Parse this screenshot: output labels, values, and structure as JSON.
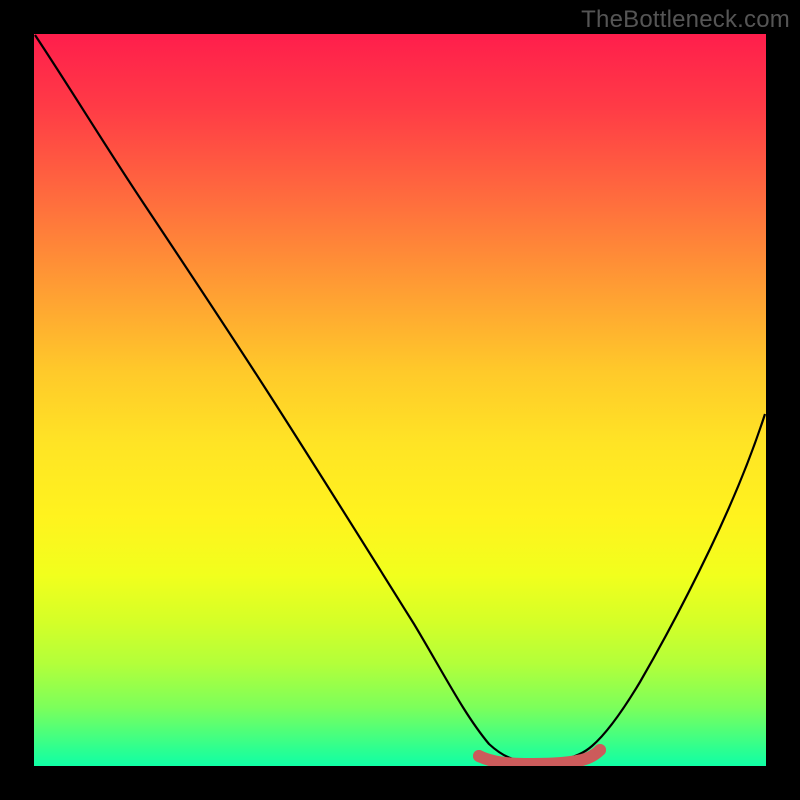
{
  "watermark": {
    "text": "TheBottleneck.com"
  },
  "chart_data": {
    "type": "line",
    "title": "",
    "xlabel": "",
    "ylabel": "",
    "xlim": [
      0,
      100
    ],
    "ylim": [
      0,
      100
    ],
    "grid": false,
    "legend": false,
    "series": [
      {
        "name": "bottleneck-curve",
        "x": [
          0,
          5,
          10,
          15,
          20,
          25,
          30,
          35,
          40,
          45,
          50,
          55,
          58,
          60,
          62,
          65,
          68,
          70,
          72,
          75,
          80,
          85,
          90,
          95,
          100
        ],
        "y": [
          100,
          94,
          86,
          78,
          70,
          62,
          54,
          46,
          38,
          30,
          22,
          14,
          8,
          4,
          2,
          1,
          1,
          1,
          2,
          3,
          8,
          16,
          26,
          38,
          52
        ]
      },
      {
        "name": "optimal-band",
        "x": [
          58,
          72
        ],
        "y": [
          1,
          1
        ]
      }
    ],
    "colors": {
      "curve": "#000000",
      "optimal_band": "#cc5b5b"
    }
  }
}
